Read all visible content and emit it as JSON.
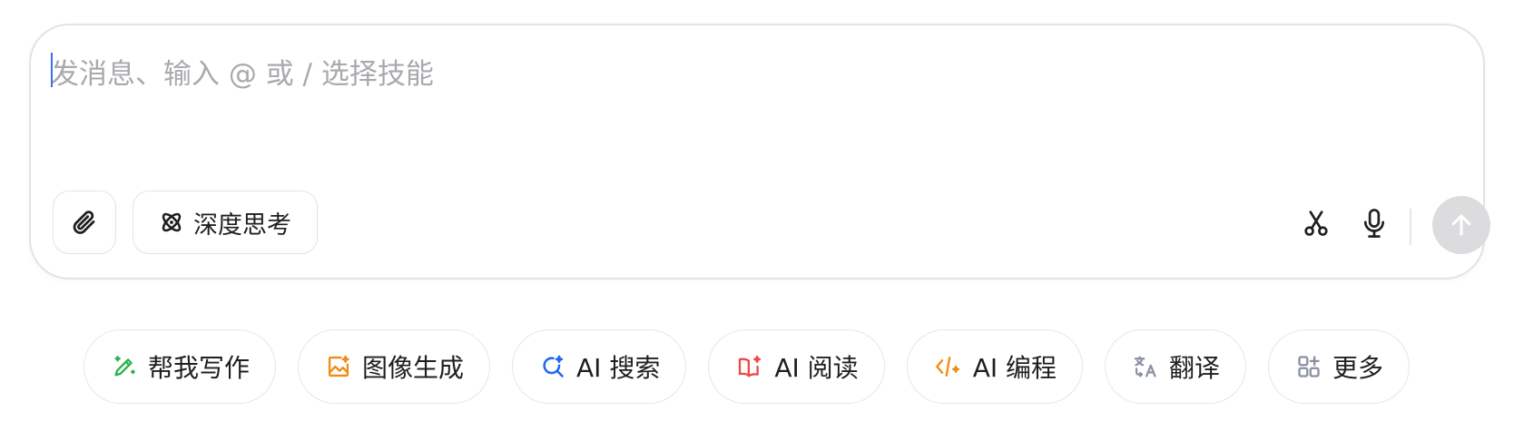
{
  "composer": {
    "placeholder": "发消息、输入 @ 或 / 选择技能",
    "value": "",
    "attach_icon": "paperclip-icon",
    "deep_think": {
      "label": "深度思考",
      "icon": "atom-icon"
    },
    "scissors_icon": "scissors-icon",
    "mic_icon": "microphone-icon",
    "send_icon": "arrow-up-icon",
    "send_disabled": true
  },
  "chips": [
    {
      "label": "帮我写作",
      "icon": "pen-sparkle-icon",
      "color": "#2bb24c"
    },
    {
      "label": "图像生成",
      "icon": "image-sparkle-icon",
      "color": "#f08c14"
    },
    {
      "label": "AI 搜索",
      "icon": "search-sparkle-icon",
      "color": "#2468f2"
    },
    {
      "label": "AI 阅读",
      "icon": "book-sparkle-icon",
      "color": "#f04848"
    },
    {
      "label": "AI 编程",
      "icon": "code-sparkle-icon",
      "color": "#f08c14"
    },
    {
      "label": "翻译",
      "icon": "translate-icon",
      "color": "#8a8fa3"
    },
    {
      "label": "更多",
      "icon": "grid-plus-icon",
      "color": "#8a8fa3"
    }
  ]
}
